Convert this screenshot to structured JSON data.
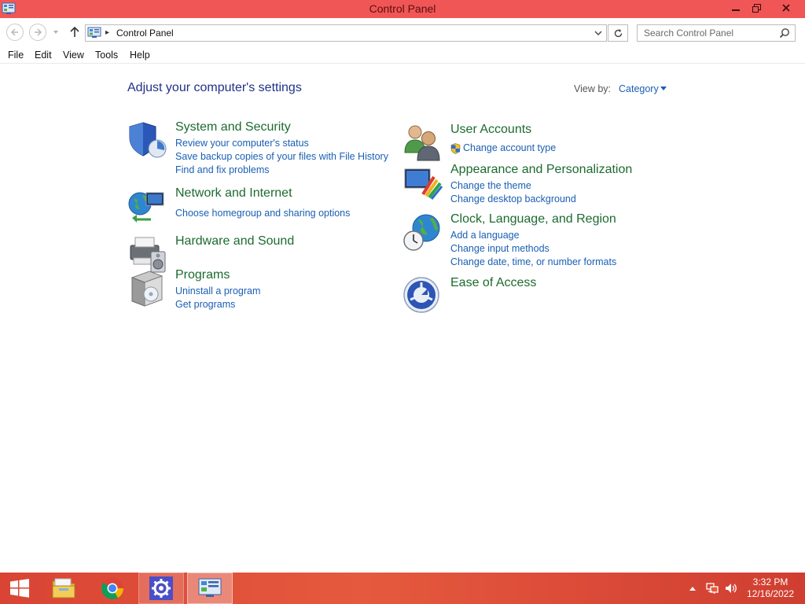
{
  "window": {
    "title": "Control Panel",
    "accent_color": "#f15656"
  },
  "address": {
    "location": "Control Panel",
    "search_placeholder": "Search Control Panel"
  },
  "menu": [
    "File",
    "Edit",
    "View",
    "Tools",
    "Help"
  ],
  "content": {
    "heading": "Adjust your computer's settings",
    "view_by_label": "View by:",
    "view_by_value": "Category",
    "categories": [
      {
        "title": "System and Security",
        "icon": "shield-icon",
        "links": [
          "Review your computer's status",
          "Save backup copies of your files with File History",
          "Find and fix problems"
        ]
      },
      {
        "title": "Network and Internet",
        "icon": "network-globe-icon",
        "links": [
          "Choose homegroup and sharing options"
        ]
      },
      {
        "title": "Hardware and Sound",
        "icon": "printer-speaker-icon",
        "links": []
      },
      {
        "title": "Programs",
        "icon": "programs-box-icon",
        "links": [
          "Uninstall a program",
          "Get programs"
        ]
      },
      {
        "title": "User Accounts",
        "icon": "users-icon",
        "links": [
          "Change account type"
        ]
      },
      {
        "title": "Appearance and Personalization",
        "icon": "monitor-palette-icon",
        "links": [
          "Change the theme",
          "Change desktop background"
        ]
      },
      {
        "title": "Clock, Language, and Region",
        "icon": "globe-clock-icon",
        "links": [
          "Add a language",
          "Change input methods",
          "Change date, time, or number formats"
        ]
      },
      {
        "title": "Ease of Access",
        "icon": "ease-of-access-icon",
        "links": []
      }
    ]
  },
  "taskbar": {
    "time": "3:32 PM",
    "date": "12/16/2022",
    "color": "#e55a3e"
  }
}
